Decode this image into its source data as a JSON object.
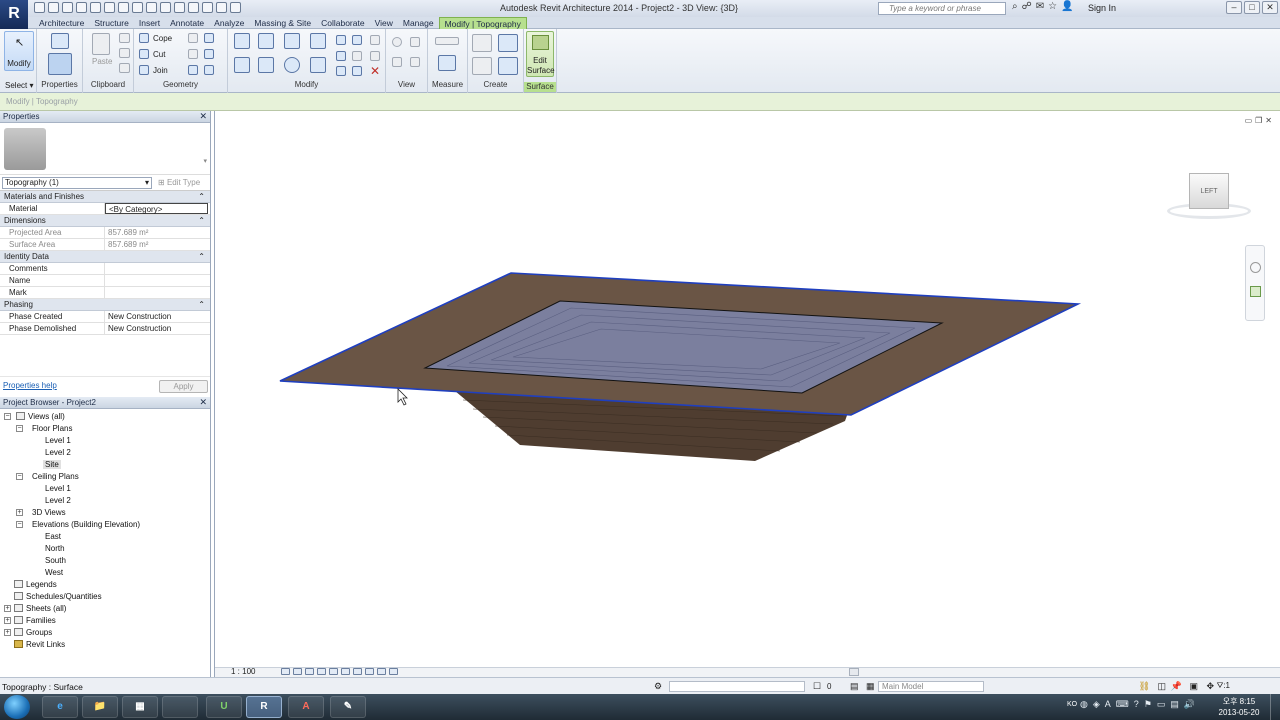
{
  "app": {
    "logo": "R",
    "title": "Autodesk Revit Architecture 2014 -     Project2 - 3D View: {3D}"
  },
  "search": {
    "placeholder": "Type a keyword or phrase"
  },
  "account": {
    "signin": "Sign In"
  },
  "window_controls": [
    "–",
    "□",
    "✕"
  ],
  "tabs": [
    "Architecture",
    "Structure",
    "Insert",
    "Annotate",
    "Analyze",
    "Massing & Site",
    "Collaborate",
    "View",
    "Manage",
    "Modify | Topography"
  ],
  "active_tab": "Modify | Topography",
  "ribbon": {
    "modify_label": "Modify",
    "paste_label": "Paste",
    "cope_label": "Cope",
    "cut_label": "Cut",
    "join_label": "Join",
    "edit_surface_label": "Edit Surface",
    "edit_surface_line1": "Edit",
    "edit_surface_line2": "Surface",
    "select_label": "Select",
    "panels": {
      "select": "Select",
      "properties": "Properties",
      "clipboard": "Clipboard",
      "geometry": "Geometry",
      "modify": "Modify",
      "view": "View",
      "measure": "Measure",
      "create": "Create",
      "surface": "Surface"
    }
  },
  "options_bar": {
    "text": "Modify | Topography"
  },
  "properties": {
    "title": "Properties",
    "type_selector": "Topography (1)",
    "edit_type": "Edit Type",
    "sections": {
      "materials": "Materials and Finishes",
      "dimensions": "Dimensions",
      "identity": "Identity Data",
      "phasing": "Phasing"
    },
    "rows": {
      "material": {
        "k": "Material",
        "v": "<By Category>"
      },
      "projected_area": {
        "k": "Projected Area",
        "v": "857.689 m²"
      },
      "surface_area": {
        "k": "Surface Area",
        "v": "857.689 m²"
      },
      "comments": {
        "k": "Comments",
        "v": ""
      },
      "name": {
        "k": "Name",
        "v": ""
      },
      "mark": {
        "k": "Mark",
        "v": ""
      },
      "phase_created": {
        "k": "Phase Created",
        "v": "New Construction"
      },
      "phase_demolished": {
        "k": "Phase Demolished",
        "v": "New Construction"
      }
    },
    "help": "Properties help",
    "apply": "Apply"
  },
  "browser": {
    "title": "Project Browser - Project2",
    "items": {
      "views": "Views (all)",
      "floor_plans": "Floor Plans",
      "fp_level1": "Level 1",
      "fp_level2": "Level 2",
      "fp_site": "Site",
      "ceiling_plans": "Ceiling Plans",
      "cp_level1": "Level 1",
      "cp_level2": "Level 2",
      "views_3d": "3D Views",
      "elevations": "Elevations (Building Elevation)",
      "east": "East",
      "north": "North",
      "south": "South",
      "west": "West",
      "legends": "Legends",
      "schedules": "Schedules/Quantities",
      "sheets": "Sheets (all)",
      "families": "Families",
      "groups": "Groups",
      "revit_links": "Revit Links"
    }
  },
  "view": {
    "scale": "1 : 100",
    "viewcube_face": "LEFT",
    "colors": {
      "terrain": "#6a5545",
      "terrain_dark": "#4f3d30",
      "pit": "#7b7f9e",
      "edge": "#1f3fbf"
    }
  },
  "statusbar": {
    "text": "Topography : Surface",
    "selected_count": "0",
    "model": "Main Model",
    "filter_count": ":1"
  },
  "taskbar": {
    "apps": [
      "e",
      "📁",
      "▦",
      "U",
      "R",
      "A",
      "✎"
    ],
    "lang": "KO",
    "time": "오후 8:15",
    "date": "2013-05-20"
  }
}
